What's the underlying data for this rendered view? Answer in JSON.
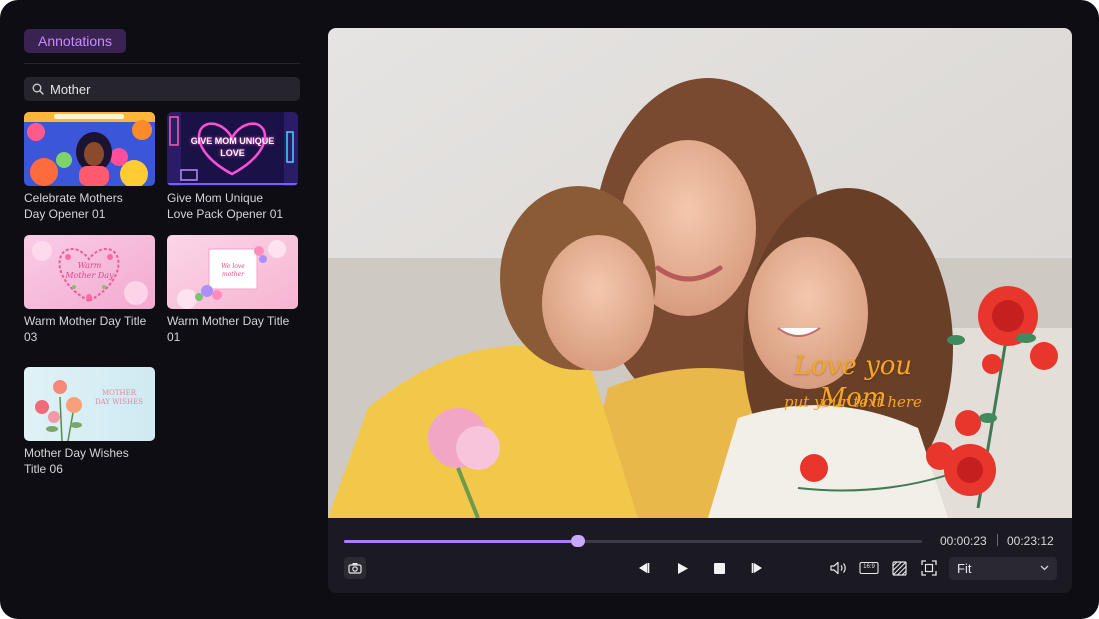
{
  "panel": {
    "tab_label": "Annotations",
    "search": {
      "value": "Mother"
    }
  },
  "templates": [
    {
      "title": "Celebrate Mothers\nDay Opener 01"
    },
    {
      "title": "Give Mom Unique\nLove Pack Opener 01",
      "thumb_text": "GIVE MOM UNIQUE\nLOVE"
    },
    {
      "title": "Warm Mother Day Title\n03",
      "thumb_text": "Warm\nMother Day"
    },
    {
      "title": "Warm Mother Day Title\n01",
      "thumb_text": "We love\nmother"
    },
    {
      "title": "Mother Day Wishes\nTitle 06",
      "thumb_text": "MOTHER\nDAY WISHES"
    }
  ],
  "video": {
    "overlay_title": "Love you Mom",
    "overlay_subtitle": "put your text here"
  },
  "playback": {
    "progress": 0.405,
    "current_time": "00:00:23",
    "total_time": "00:23:12",
    "aspect_label": "16:9",
    "fit_option": "Fit"
  },
  "icons": [
    "search-icon",
    "snapshot-icon",
    "prev-frame-icon",
    "play-icon",
    "stop-icon",
    "next-frame-icon",
    "volume-icon",
    "aspect-ratio-icon",
    "safe-zone-icon",
    "fullscreen-icon",
    "chevron-down-icon"
  ],
  "colors": {
    "accent": "#b07bff",
    "tab_text": "#c78bff",
    "overlay_text": "#f5a623"
  }
}
